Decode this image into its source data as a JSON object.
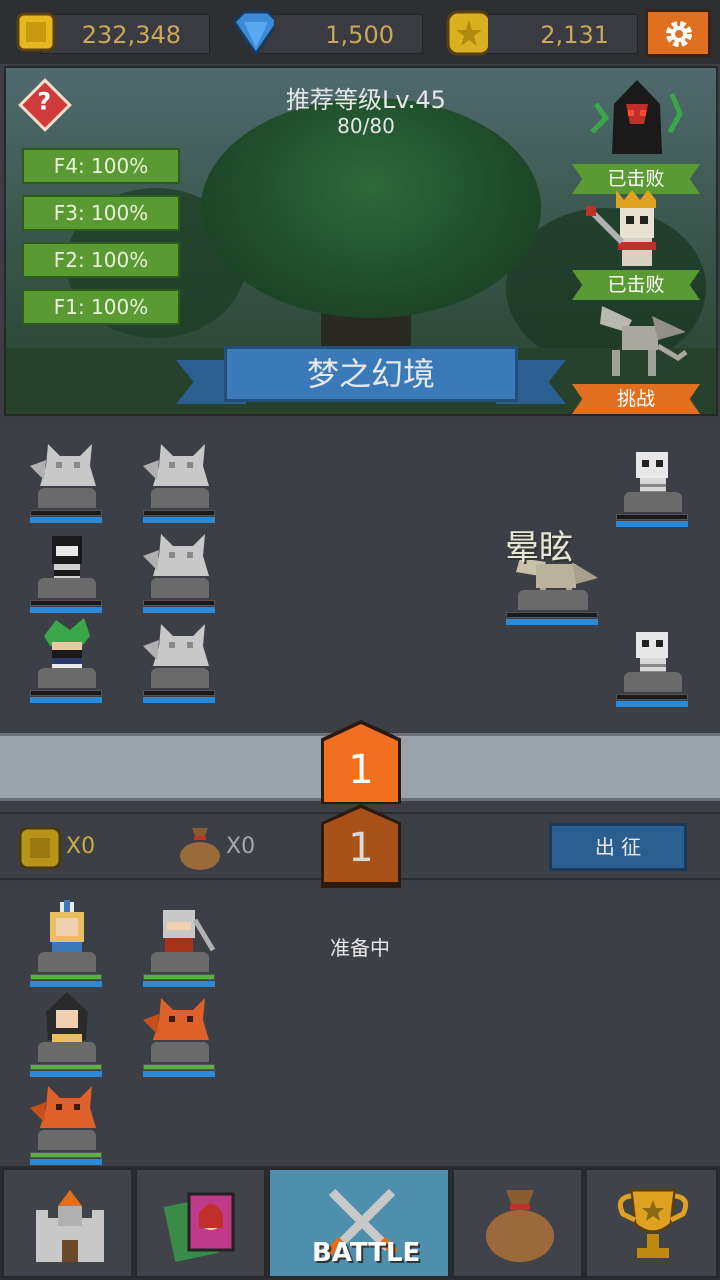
{
  "currency": {
    "gold": "232,348",
    "gems": "1,500",
    "stars": "2,131"
  },
  "stage": {
    "recommended": "推荐等级Lv.45",
    "progress": "80/80",
    "name": "梦之幻境",
    "floors": [
      "F4: 100%",
      "F3: 100%",
      "F2: 100%",
      "F1: 100%"
    ],
    "bosses": [
      {
        "status": "已击败"
      },
      {
        "status": "已击败"
      },
      {
        "status": "挑战"
      }
    ]
  },
  "battle": {
    "stun_label": "晕眩",
    "wave_active": "1",
    "wave_next": "1"
  },
  "loot": {
    "gold_count": "X0",
    "bag_count": "X0",
    "deploy_label": "出 征"
  },
  "reserve": {
    "status": "准备中"
  },
  "nav": {
    "battle_label": "BATTLE"
  },
  "colors": {
    "accent_orange": "#e07020",
    "stage_green": "#5a9a32",
    "banner_blue": "#3a7ab8",
    "hp_blue": "#2a8ad8",
    "hp_green": "#5ab040"
  }
}
